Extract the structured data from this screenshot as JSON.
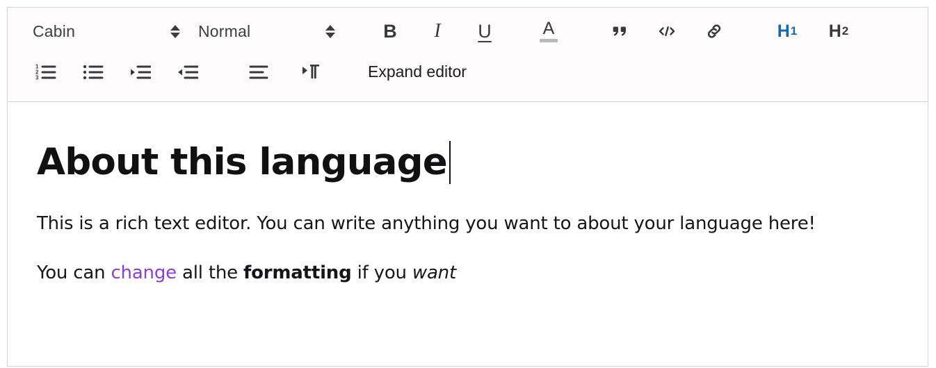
{
  "toolbar": {
    "font_select": {
      "value": "Cabin",
      "icon": "chevron-updown-icon"
    },
    "format_select": {
      "value": "Normal",
      "icon": "chevron-updown-icon"
    },
    "bold_label": "B",
    "italic_label": "I",
    "underline_label": "U",
    "text_color_label": "A",
    "text_color_swatch": "#b9b9b9",
    "blockquote_icon": "blockquote-icon",
    "code_icon": "code-icon",
    "link_icon": "link-icon",
    "heading1": {
      "label": "H",
      "sub": "1",
      "active": true,
      "color": "#1468ad"
    },
    "heading2": {
      "label": "H",
      "sub": "2",
      "active": false,
      "color": "#38393c"
    },
    "ordered_list_icon": "ordered-list-icon",
    "bullet_list_icon": "bullet-list-icon",
    "indent_icon": "indent-increase-icon",
    "outdent_icon": "indent-decrease-icon",
    "align_left_icon": "align-left-icon",
    "text_direction_icon": "text-direction-ltr-icon",
    "expand_editor_label": "Expand editor"
  },
  "document": {
    "title": "About this language",
    "paragraph1": "This is a rich text editor. You can write anything you want to about your language here!",
    "paragraph2": {
      "part1": "You can ",
      "colored": "change",
      "part2": " all the ",
      "bold": "formatting",
      "part3": " if you ",
      "italic": "want"
    }
  },
  "colors": {
    "accent_blue": "#1468ad",
    "text_purple": "#8c3fd4",
    "toolbar_bg": "#fdfbfc",
    "border": "#d6d3d6",
    "icon_gray": "#38393c"
  }
}
